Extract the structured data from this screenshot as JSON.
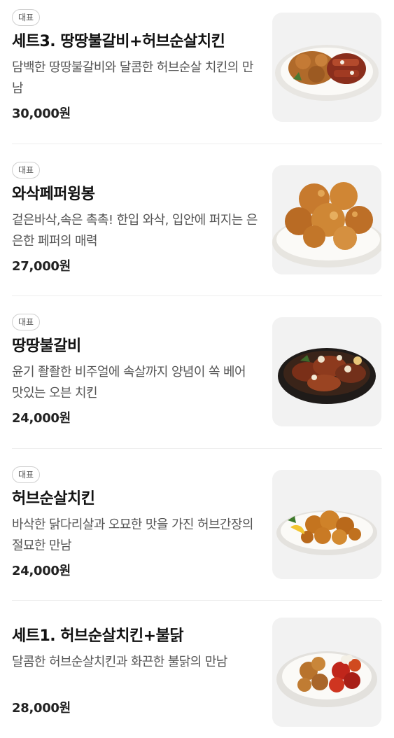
{
  "menu": {
    "items": [
      {
        "badge": "대표",
        "name": "세트3. 땅땅불갈비+허브순살치킨",
        "desc": "담백한 땅땅불갈비와 달콤한 허브순살 치킨의 만남",
        "price": "30,000원",
        "image": "chicken-set-platter"
      },
      {
        "badge": "대표",
        "name": "와삭페퍼윙봉",
        "desc": "겉은바삭,속은 촉촉! 한입 와삭, 입안에 퍼지는 은은한 페퍼의 매력",
        "price": "27,000원",
        "image": "fried-wings-plate"
      },
      {
        "badge": "대표",
        "name": "땅땅불갈비",
        "desc": "윤기 좔좔한 비주얼에 속살까지 양념이 쏙 베어 맛있는 오븐 치킨",
        "price": "24,000원",
        "image": "grilled-chicken-pan"
      },
      {
        "badge": "대표",
        "name": "허브순살치킨",
        "desc": "바삭한 닭다리살과 오묘한 맛을 가진 허브간장의 절묘한 만남",
        "price": "24,000원",
        "image": "boneless-chicken-plate"
      },
      {
        "name": "세트1. 허브순살치킨+불닭",
        "desc": "달콤한 허브순살치킨과 화끈한 불닭의 만남",
        "price": "28,000원",
        "image": "spicy-chicken-set-plate"
      }
    ]
  }
}
